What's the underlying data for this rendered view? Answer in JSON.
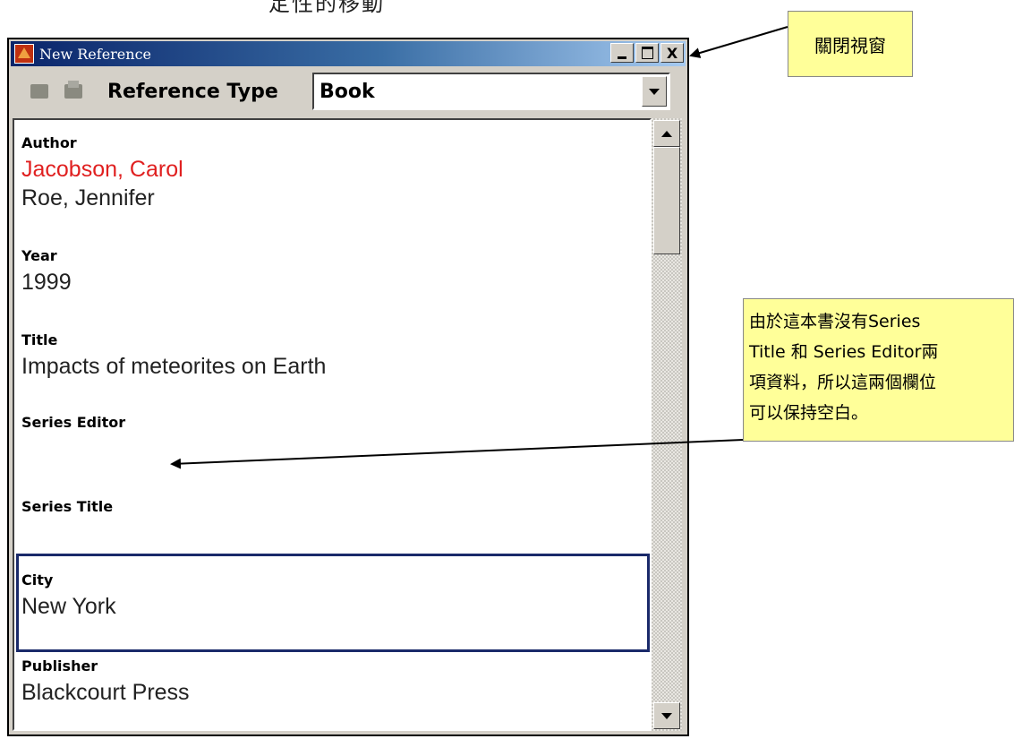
{
  "top_caption": "定性的移動",
  "window": {
    "title": "New Reference",
    "buttons": {
      "minimize": "_",
      "maximize": "□",
      "close": "X"
    }
  },
  "toolbar": {
    "icons": [
      "back-icon",
      "folder-icon"
    ],
    "reference_type_label": "Reference Type",
    "reference_type_value": "Book"
  },
  "fields": {
    "author": {
      "label": "Author",
      "values": [
        "Jacobson, Carol",
        "Roe, Jennifer"
      ]
    },
    "year": {
      "label": "Year",
      "value": "1999"
    },
    "title": {
      "label": "Title",
      "value": "Impacts of meteorites on Earth"
    },
    "series_editor": {
      "label": "Series Editor",
      "value": ""
    },
    "series_title": {
      "label": "Series Title",
      "value": ""
    },
    "city": {
      "label": "City",
      "value": "New York"
    },
    "publisher": {
      "label": "Publisher",
      "value": "Blackcourt Press"
    }
  },
  "colors": {
    "highlight_author": "#e02020",
    "callout_bg": "#ffff99",
    "title_bar": "#0a246a"
  },
  "callouts": {
    "close_window": "關閉視窗",
    "series_note": [
      "由於這本書沒有Series",
      "Title  和  Series Editor兩",
      "項資料，所以這兩個欄位",
      "可以保持空白。"
    ]
  }
}
